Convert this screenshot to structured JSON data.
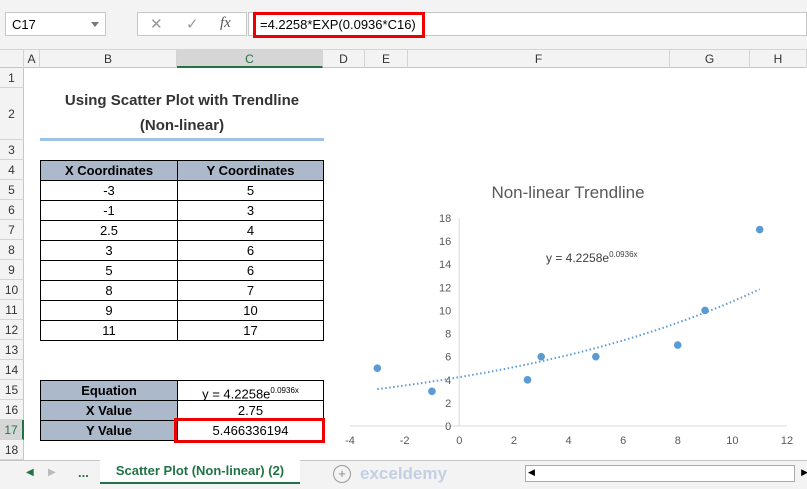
{
  "formula_bar": {
    "name_box": "C17",
    "cancel_icon": "✕",
    "enter_icon": "✓",
    "fx_label": "fx",
    "formula": "=4.2258*EXP(0.0936*C16)"
  },
  "columns": [
    "A",
    "B",
    "C",
    "D",
    "E",
    "F",
    "G",
    "H"
  ],
  "rows": [
    "1",
    "2",
    "3",
    "4",
    "5",
    "6",
    "7",
    "8",
    "9",
    "10",
    "11",
    "12",
    "13",
    "14",
    "15",
    "16",
    "17",
    "18"
  ],
  "title": {
    "line1": "Using Scatter Plot with Trendline",
    "line2": "(Non-linear)"
  },
  "table": {
    "headers": [
      "X Coordinates",
      "Y Coordinates"
    ],
    "rows": [
      [
        "-3",
        "5"
      ],
      [
        "-1",
        "3"
      ],
      [
        "2.5",
        "4"
      ],
      [
        "3",
        "6"
      ],
      [
        "5",
        "6"
      ],
      [
        "8",
        "7"
      ],
      [
        "9",
        "10"
      ],
      [
        "11",
        "17"
      ]
    ]
  },
  "results": {
    "equation_label": "Equation",
    "equation_base": "y = 4.2258e",
    "equation_exp": "0.0936x",
    "x_label": "X Value",
    "x_value": "2.75",
    "y_label": "Y Value",
    "y_value": "5.466336194"
  },
  "chart_data": {
    "type": "scatter",
    "title": "Non-linear Trendline",
    "x": [
      -3,
      -1,
      2.5,
      3,
      5,
      8,
      9,
      11
    ],
    "y": [
      5,
      3,
      4,
      6,
      6,
      7,
      10,
      17
    ],
    "xlim": [
      -4,
      12
    ],
    "ylim": [
      0,
      18
    ],
    "xticks": [
      "-4",
      "-2",
      "0",
      "2",
      "4",
      "6",
      "8",
      "10",
      "12"
    ],
    "yticks": [
      "0",
      "2",
      "4",
      "6",
      "8",
      "10",
      "12",
      "14",
      "16",
      "18"
    ],
    "trendline": {
      "type": "exponential",
      "a": 4.2258,
      "b": 0.0936,
      "label_base": "y = 4.2258e",
      "label_exp": "0.0936x"
    },
    "color": "#5b9bd5"
  },
  "tabs": {
    "ellipsis": "...",
    "active": "Scatter Plot (Non-linear)  (2)",
    "add": "+"
  },
  "watermark": "exceldemy"
}
